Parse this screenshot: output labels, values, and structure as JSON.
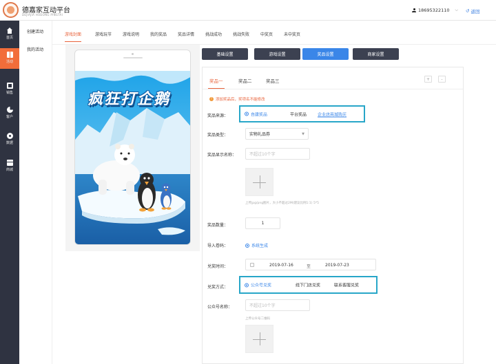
{
  "brand": {
    "title": "德嘉家互动平台",
    "subtitle": "DEJIAJIA HUDONG PINGTAI"
  },
  "user": {
    "phone": "18695322110",
    "caret": "⌵"
  },
  "header": {
    "return_label": "返回"
  },
  "left_nav": [
    {
      "label": "首页",
      "icon": "home-icon"
    },
    {
      "label": "活动",
      "icon": "gift-icon"
    },
    {
      "label": "销售",
      "icon": "sales-icon"
    },
    {
      "label": "客户",
      "icon": "pie-icon"
    },
    {
      "label": "数据",
      "icon": "data-icon"
    },
    {
      "label": "商城",
      "icon": "mall-icon"
    }
  ],
  "sub_nav": [
    {
      "label": "创建活动"
    },
    {
      "label": "我的活动"
    }
  ],
  "tabs": [
    {
      "label": "游戏封面"
    },
    {
      "label": "游戏玩节"
    },
    {
      "label": "游戏说明"
    },
    {
      "label": "我的奖品"
    },
    {
      "label": "奖品详情"
    },
    {
      "label": "挑战成功"
    },
    {
      "label": "挑战失败"
    },
    {
      "label": "中奖页"
    },
    {
      "label": "未中奖页"
    }
  ],
  "preview": {
    "game_title": "疯狂打企鹅"
  },
  "control_buttons": [
    {
      "label": "基础设置"
    },
    {
      "label": "游戏设置"
    },
    {
      "label": "奖品设置"
    },
    {
      "label": "商家设置"
    }
  ],
  "prize_tabs": [
    {
      "label": "奖品一"
    },
    {
      "label": "奖品二"
    },
    {
      "label": "奖品三"
    }
  ],
  "prize_tab_controls": {
    "add": "+",
    "remove": "-"
  },
  "notice": "添加奖品后，奖项名不能修改",
  "form": {
    "source_label": "奖品来源：",
    "source_options": [
      {
        "label": "自建奖品"
      },
      {
        "label": "平台奖品"
      },
      {
        "label": "企业店商城购买"
      }
    ],
    "type_label": "奖品类型：",
    "type_value": "实物礼品券",
    "name_label": "奖品显示名称：",
    "name_placeholder": "不超过10个字",
    "image_hint": "上传jpg/png图片，大小不超过2M(建议比例1:1) 5*5",
    "quantity_label": "奖品数量：",
    "quantity_value": "1",
    "import_label": "导入卷码：",
    "import_value": "系统生成",
    "time_label": "兑奖时间：",
    "time_start": "2019-07-16",
    "time_sep": "至",
    "time_end": "2019-07-23",
    "method_label": "兑奖方式：",
    "method_options": [
      {
        "label": "公众号兑奖"
      },
      {
        "label": "线下门店兑奖"
      },
      {
        "label": "联系客服兑奖"
      }
    ],
    "official_label": "公众号名称：",
    "official_placeholder": "不超过10个字",
    "qr_hint": "上传公众号二维码"
  },
  "colors": {
    "accent": "#e8623a",
    "nav_active": "#f26d3a",
    "primary_btn": "#3a86e8",
    "dark_btn": "#3c4151",
    "highlight_box": "#27a6c8"
  }
}
